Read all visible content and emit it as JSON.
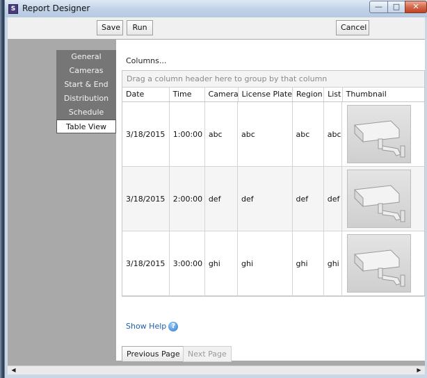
{
  "window": {
    "title": "Report Designer",
    "icon_letter": "S"
  },
  "toolbar": {
    "save": "Save",
    "run": "Run",
    "cancel": "Cancel"
  },
  "nav": [
    {
      "label": "General",
      "active": false
    },
    {
      "label": "Cameras",
      "active": false
    },
    {
      "label": "Start & End",
      "active": false
    },
    {
      "label": "Distribution",
      "active": false
    },
    {
      "label": "Schedule",
      "active": false
    },
    {
      "label": "Table View",
      "active": true
    }
  ],
  "panel": {
    "columns_link": "Columns...",
    "group_placeholder": "Drag a column header here to group by that column",
    "headers": [
      "Date",
      "Time",
      "Camera",
      "License Plate",
      "Region",
      "List",
      "Thumbnail"
    ],
    "rows": [
      [
        "3/18/2015",
        "1:00:00",
        "abc",
        "abc",
        "abc",
        "abc"
      ],
      [
        "3/18/2015",
        "2:00:00",
        "def",
        "def",
        "def",
        "def"
      ],
      [
        "3/18/2015",
        "3:00:00",
        "ghi",
        "ghi",
        "ghi",
        "ghi"
      ]
    ],
    "thumbnail_icon": "security-camera-thumbnail",
    "show_help": "Show Help",
    "previous_page": "Previous Page",
    "next_page": "Next Page"
  }
}
